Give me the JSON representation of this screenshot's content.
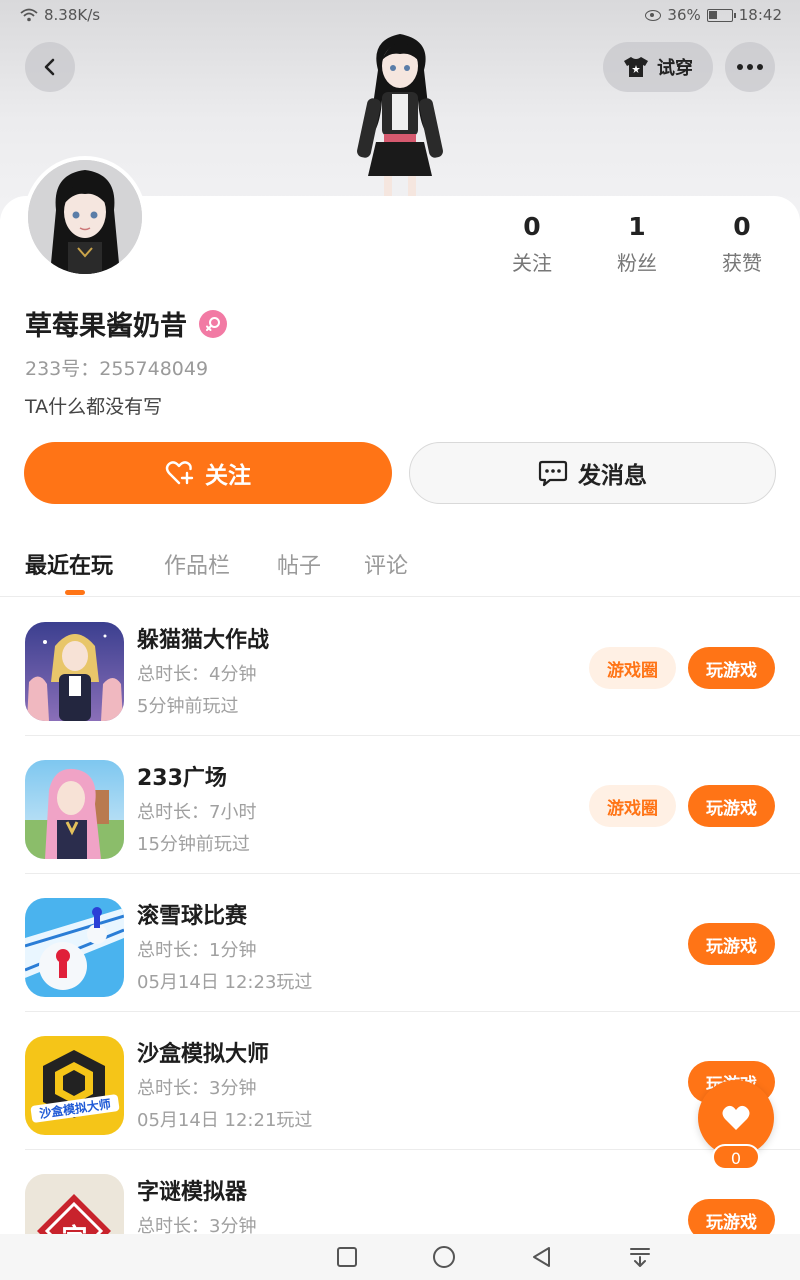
{
  "status_bar": {
    "speed": "8.38K/s",
    "battery": "36%",
    "time": "18:42"
  },
  "header": {
    "try_on_label": "试穿"
  },
  "profile": {
    "stats": [
      {
        "value": "0",
        "label": "关注"
      },
      {
        "value": "1",
        "label": "粉丝"
      },
      {
        "value": "0",
        "label": "获赞"
      }
    ],
    "username": "草莓果酱奶昔",
    "user_id": "233号：255748049",
    "bio": "TA什么都没有写"
  },
  "actions": {
    "follow_label": "关注",
    "message_label": "发消息"
  },
  "tabs": [
    {
      "label": "最近在玩",
      "active": true
    },
    {
      "label": "作品栏",
      "active": false
    },
    {
      "label": "帖子",
      "active": false
    },
    {
      "label": "评论",
      "active": false
    }
  ],
  "games": [
    {
      "name": "躲猫猫大作战",
      "duration": "总时长：4分钟",
      "last_played": "5分钟前玩过",
      "circle_label": "游戏圈",
      "play_label": "玩游戏",
      "icon": "hide-and-seek-game-icon"
    },
    {
      "name": "233广场",
      "duration": "总时长：7小时",
      "last_played": "15分钟前玩过",
      "circle_label": "游戏圈",
      "play_label": "玩游戏",
      "icon": "plaza-game-icon"
    },
    {
      "name": "滚雪球比赛",
      "duration": "总时长：1分钟",
      "last_played": "05月14日 12:23玩过",
      "play_label": "玩游戏",
      "icon": "snowball-race-game-icon"
    },
    {
      "name": "沙盒模拟大师",
      "duration": "总时长：3分钟",
      "last_played": "05月14日 12:21玩过",
      "play_label": "玩游戏",
      "icon": "sandbox-master-game-icon",
      "icon_text": "沙盒模拟大师"
    },
    {
      "name": "字谜模拟器",
      "duration": "总时长：3分钟",
      "last_played": "",
      "play_label": "玩游戏",
      "icon": "word-puzzle-game-icon",
      "icon_text": "字"
    }
  ],
  "like_fab": {
    "count": "0"
  },
  "colors": {
    "accent": "#ff7416",
    "accent_light": "#fff0e4",
    "female": "#f27aa4"
  }
}
